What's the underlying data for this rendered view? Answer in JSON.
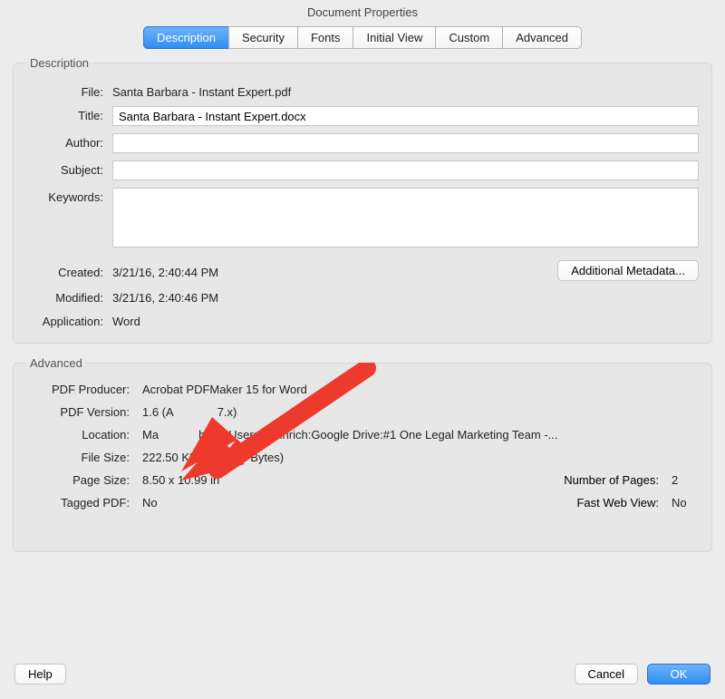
{
  "window": {
    "title": "Document Properties"
  },
  "tabs": [
    "Description",
    "Security",
    "Fonts",
    "Initial View",
    "Custom",
    "Advanced"
  ],
  "description_group": {
    "legend": "Description",
    "labels": {
      "file": "File:",
      "title": "Title:",
      "author": "Author:",
      "subject": "Subject:",
      "keywords": "Keywords:",
      "created": "Created:",
      "modified": "Modified:",
      "application": "Application:"
    },
    "values": {
      "file": "Santa Barbara - Instant Expert.pdf",
      "title": "Santa Barbara - Instant Expert.docx",
      "author": "",
      "subject": "",
      "keywords": "",
      "created": "3/21/16, 2:40:44 PM",
      "modified": "3/21/16, 2:40:46 PM",
      "application": "Word"
    },
    "additional_metadata_btn": "Additional Metadata..."
  },
  "advanced_group": {
    "legend": "Advanced",
    "labels": {
      "producer": "PDF Producer:",
      "version": "PDF Version:",
      "location": "Location:",
      "file_size": "File Size:",
      "page_size": "Page Size:",
      "num_pages": "Number of Pages:",
      "tagged": "Tagged PDF:",
      "fast_web": "Fast Web View:"
    },
    "values": {
      "producer": "Acrobat PDFMaker 15 for Word",
      "version_a": "1.6 (A",
      "version_b": "7.x)",
      "location_a": "Ma",
      "location_b": "h HD:Users:rheinrich:Google Drive:#1 One Legal Marketing Team -...",
      "file_size": "222.50 KB (227,841 Bytes)",
      "page_size": "8.50 x 10.99 in",
      "num_pages": "2",
      "tagged": "No",
      "fast_web": "No"
    }
  },
  "buttons": {
    "help": "Help",
    "cancel": "Cancel",
    "ok": "OK"
  },
  "annotation": {
    "arrow_color": "#ee3a2c"
  }
}
